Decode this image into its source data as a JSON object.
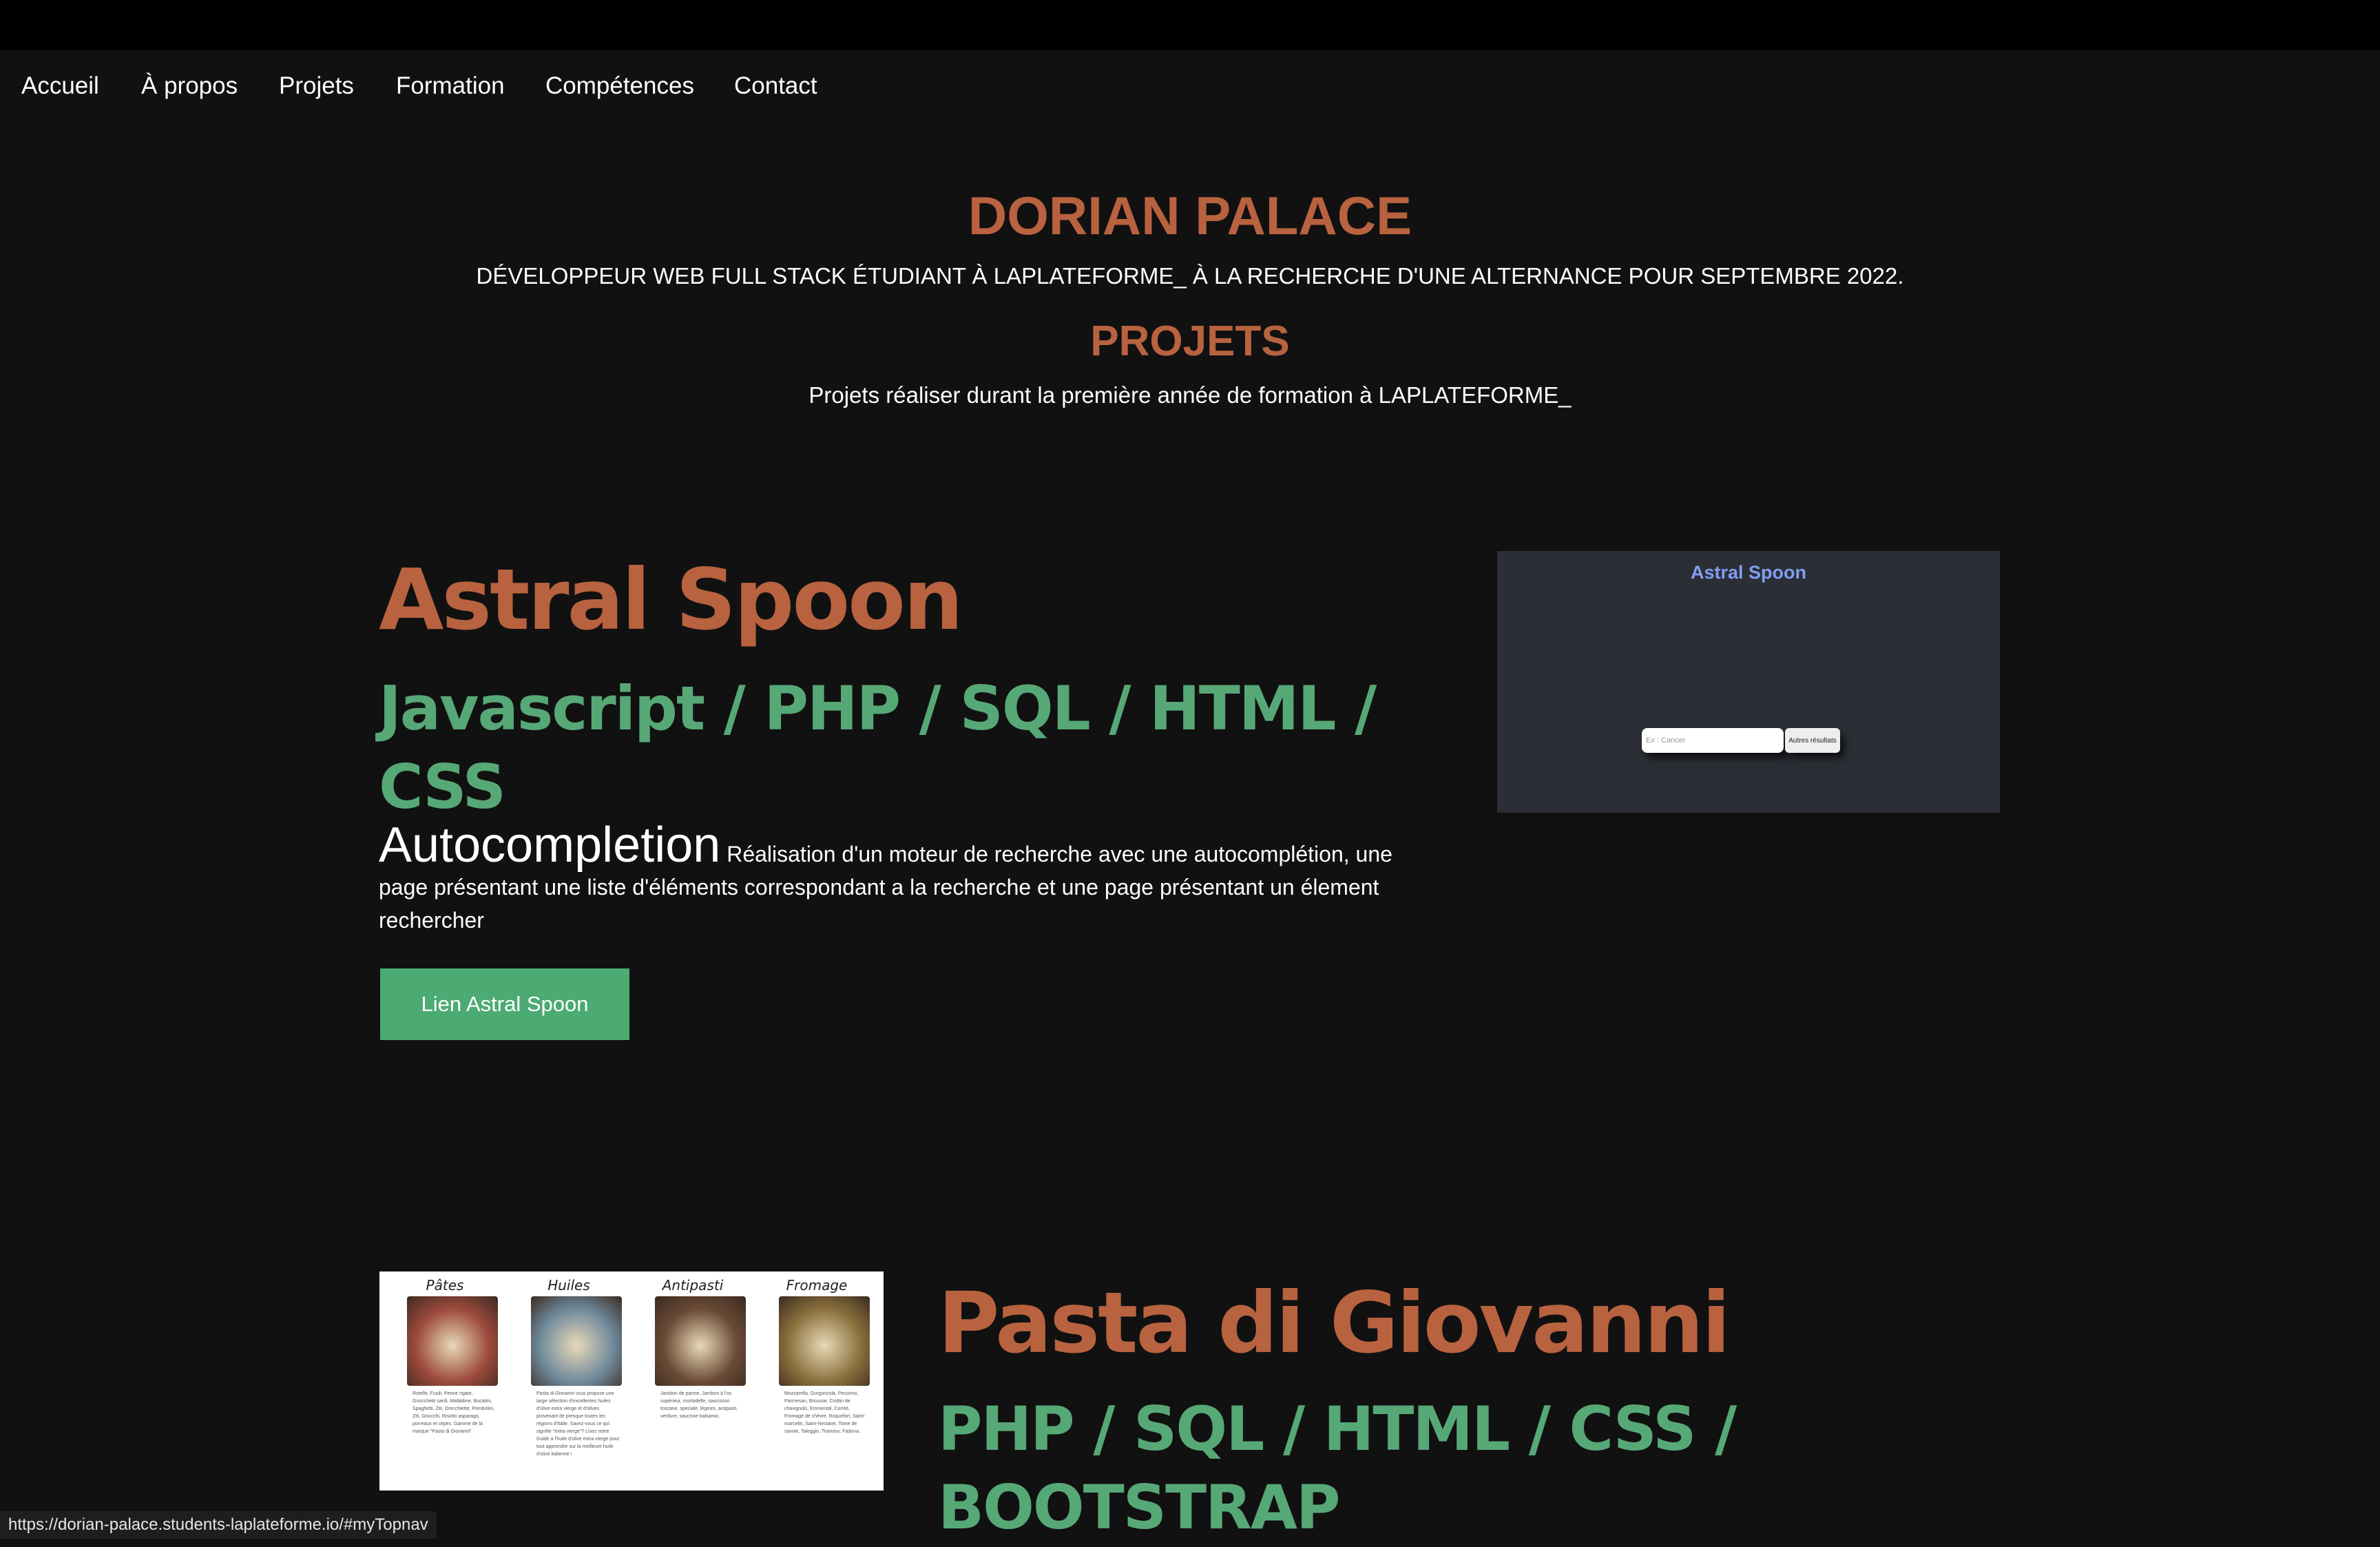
{
  "nav": {
    "items": [
      "Accueil",
      "À propos",
      "Projets",
      "Formation",
      "Compétences",
      "Contact"
    ]
  },
  "header": {
    "name": "DORIAN PALACE",
    "tagline": "DÉVELOPPEUR WEB FULL STACK ÉTUDIANT À LAPLATEFORME_ À LA RECHERCHE D'UNE ALTERNANCE POUR SEPTEMBRE 2022."
  },
  "section": {
    "title": "PROJETS",
    "subtitle": "Projets réaliser durant la première année de formation à LAPLATEFORME_"
  },
  "projects": [
    {
      "name": "Astral Spoon",
      "tech": "Javascript / PHP / SQL / HTML / CSS",
      "subtitle": "Autocompletion",
      "description": "Réalisation d'un moteur de recherche avec une autocomplétion, une page présentant une liste d'éléments correspondant a la recherche et une page présentant un élement rechercher",
      "button": "Lien Astral Spoon",
      "screenshot": {
        "title": "Astral Spoon",
        "input_placeholder": "Ex : Cancer",
        "button": "Autres résultats"
      }
    },
    {
      "name": "Pasta di Giovanni",
      "tech": "PHP / SQL / HTML / CSS / BOOTSTRAP",
      "screenshot": {
        "columns": [
          {
            "title": "Pâtes",
            "text": "Rotelle, Fusili, Penne rigate, Gnocchetti sardi, Mafaldine, Bucatini, Spaghetti, Ziti, Orecchiette, Pombolini, Ziti, Gnocchi, Risotto asparago, porreaux et cèpes. Gamme de la marque \"Pasta di Giovanni\".",
            "color": "#9c4a3c"
          },
          {
            "title": "Huiles",
            "text": "Pasta di Giovanni vous propose une large sélection d'excellentes huiles d'olive extra vierge et d'olives provenant de presque toutes les régions d'Italie. Savez-vous ce qui signifie \"extra vierge\"? Lisez notre Guide à l'huile d'olive extra vierge pour tout apprendre sur la meilleure huile d'olive italienne !",
            "color": "#6f8a9c"
          },
          {
            "title": "Antipasti",
            "text": "Jambon de parme, Jambon à l'os supérieur, mortadelle, saucisson toscane, speciale, légines, antipasti, verdure, saucisse balsamic.",
            "color": "#6a4a35"
          },
          {
            "title": "Fromage",
            "text": "Mozzarella, Gorgonzola, Pecorino, Parmesan, Brousse, Crottin de chavignols, Emmental, Comté, Fromage de chèvre, Roquefort, Saint-marcelin, Saint-Nectaire, Tome de savoie, Taleggio, Tiramisu, Fadona.",
            "color": "#8a6f3c"
          }
        ]
      }
    }
  ],
  "status_bar": {
    "url": "https://dorian-palace.students-laplateforme.io/#myTopnav"
  }
}
